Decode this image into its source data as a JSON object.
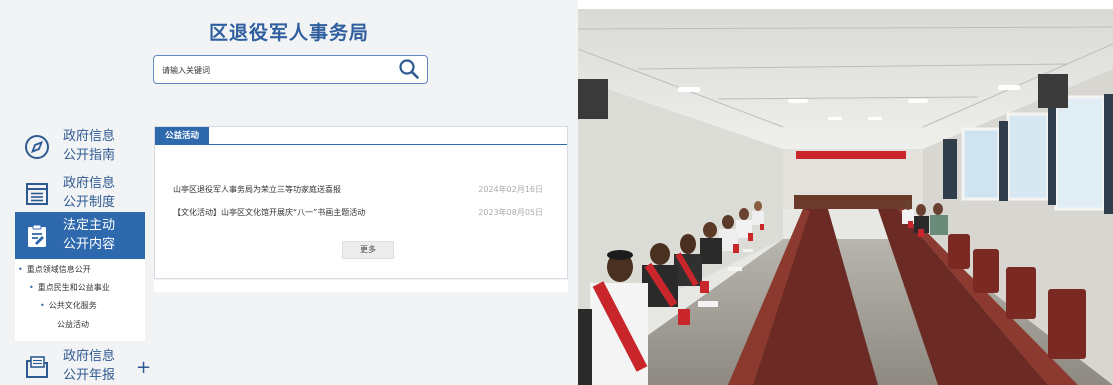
{
  "site": {
    "title": "区退役军人事务局"
  },
  "search": {
    "placeholder": "请输入关键词"
  },
  "nav": [
    {
      "line1": "政府信息",
      "line2": "公开指南",
      "icon": "compass-icon",
      "active": false
    },
    {
      "line1": "政府信息",
      "line2": "公开制度",
      "icon": "document-list-icon",
      "active": false
    },
    {
      "line1": "法定主动",
      "line2": "公开内容",
      "icon": "clipboard-edit-icon",
      "active": true
    },
    {
      "line1": "政府信息",
      "line2": "公开年报",
      "icon": "folder-report-icon",
      "active": false,
      "expand": "+"
    }
  ],
  "subnav": {
    "level1": "重点领域信息公开",
    "level2": "重点民生和公益事业",
    "level3": "公共文化服务",
    "level4": "公益活动"
  },
  "panel": {
    "tab": "公益活动",
    "items": [
      {
        "title": "山亭区退役军人事务局为荣立三等功家庭送喜报",
        "date": "2024年02月16日"
      },
      {
        "title": "【文化活动】山亭区文化馆开展庆“八一”书画主题活动",
        "date": "2023年08月05日"
      }
    ],
    "more": "更多"
  },
  "colors": {
    "brand": "#2f69ad",
    "title": "#2f5f9e",
    "banner_red": "#c8262b"
  }
}
